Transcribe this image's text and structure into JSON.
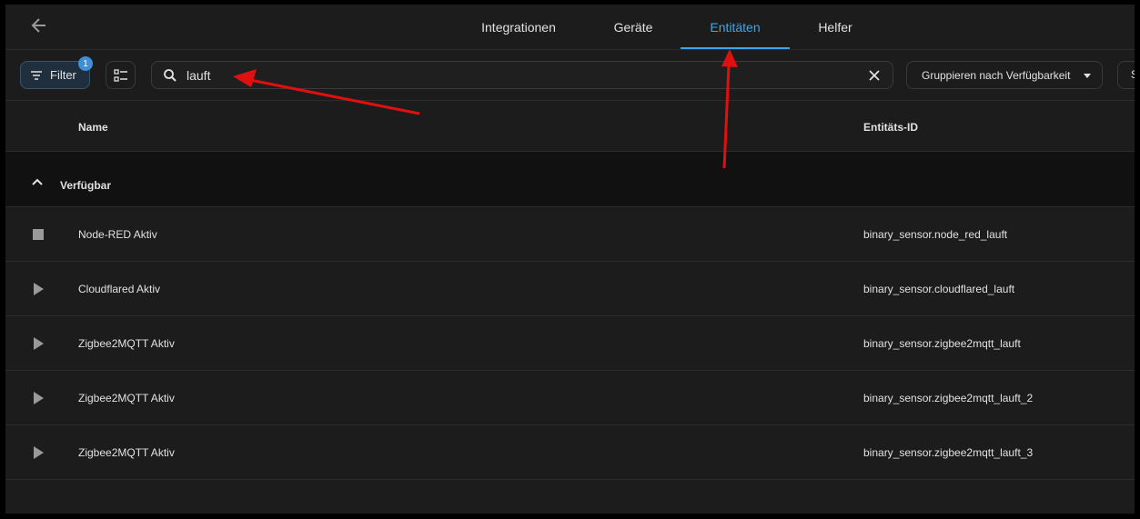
{
  "header": {
    "tabs": [
      {
        "label": "Integrationen"
      },
      {
        "label": "Geräte"
      },
      {
        "label": "Entitäten",
        "active": true
      },
      {
        "label": "Helfer"
      }
    ]
  },
  "toolbar": {
    "filter_label": "Filter",
    "filter_badge": "1",
    "search_value": "lauft",
    "group_label": "Gruppieren nach Verfügbarkeit",
    "sort_label": "S"
  },
  "table": {
    "columns": {
      "name": "Name",
      "entity_id": "Entitäts-ID"
    },
    "group": {
      "label": "Verfügbar"
    },
    "rows": [
      {
        "name": "Node-RED Aktiv",
        "entity_id": "binary_sensor.node_red_lauft",
        "icon": "stop-icon"
      },
      {
        "name": "Cloudflared Aktiv",
        "entity_id": "binary_sensor.cloudflared_lauft",
        "icon": "play-icon"
      },
      {
        "name": "Zigbee2MQTT Aktiv",
        "entity_id": "binary_sensor.zigbee2mqtt_lauft",
        "icon": "play-icon"
      },
      {
        "name": "Zigbee2MQTT Aktiv",
        "entity_id": "binary_sensor.zigbee2mqtt_lauft_2",
        "icon": "play-icon"
      },
      {
        "name": "Zigbee2MQTT Aktiv",
        "entity_id": "binary_sensor.zigbee2mqtt_lauft_3",
        "icon": "play-icon"
      }
    ]
  },
  "colors": {
    "accent": "#3ea6e8",
    "background": "#1c1c1c",
    "annotation_arrow": "#e01010"
  }
}
